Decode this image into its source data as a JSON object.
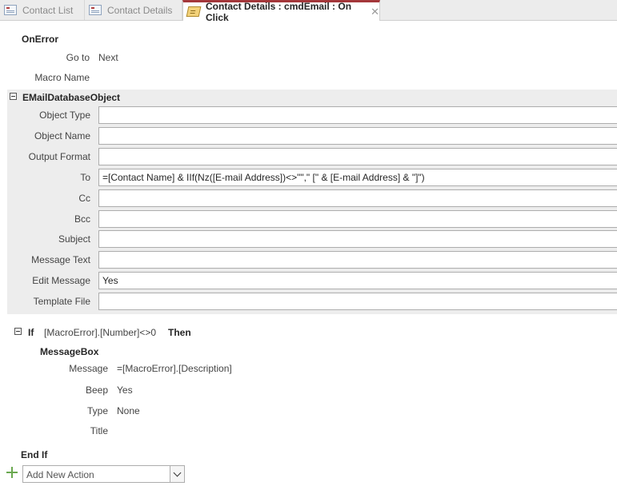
{
  "tabs": [
    {
      "label": "Contact List"
    },
    {
      "label": "Contact Details"
    },
    {
      "label": "Contact Details : cmdEmail : On Click",
      "close": "✕"
    }
  ],
  "on_error": {
    "title": "OnError",
    "goto_label": "Go to",
    "goto_value": "Next",
    "macro_name_label": "Macro Name",
    "macro_name_value": ""
  },
  "email_action": {
    "title": "EMailDatabaseObject",
    "fields": [
      {
        "label": "Object Type",
        "value": ""
      },
      {
        "label": "Object Name",
        "value": ""
      },
      {
        "label": "Output Format",
        "value": ""
      },
      {
        "label": "To",
        "value": "=[Contact Name] & IIf(Nz([E-mail Address])<>\"\",\" [\" & [E-mail Address] & \"]\")"
      },
      {
        "label": "Cc",
        "value": ""
      },
      {
        "label": "Bcc",
        "value": ""
      },
      {
        "label": "Subject",
        "value": ""
      },
      {
        "label": "Message Text",
        "value": ""
      },
      {
        "label": "Edit Message",
        "value": "Yes"
      },
      {
        "label": "Template File",
        "value": ""
      }
    ]
  },
  "if_block": {
    "if_keyword": "If",
    "condition": "[MacroError].[Number]<>0",
    "then_keyword": "Then",
    "action_title": "MessageBox",
    "args": [
      {
        "label": "Message",
        "value": "=[MacroError].[Description]"
      },
      {
        "label": "Beep",
        "value": "Yes"
      },
      {
        "label": "Type",
        "value": "None"
      },
      {
        "label": "Title",
        "value": ""
      }
    ],
    "end_keyword": "End If"
  },
  "add_action": {
    "placeholder": "Add New Action"
  }
}
